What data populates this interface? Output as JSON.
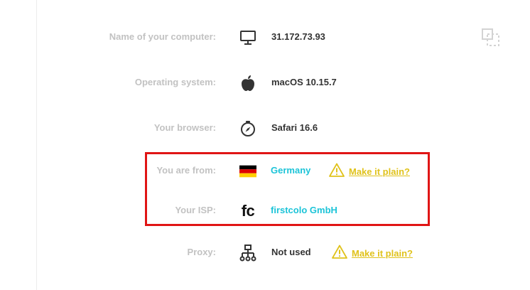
{
  "rows": [
    {
      "label": "Name of your computer:",
      "value": "31.172.73.93",
      "icon": "monitor-icon"
    },
    {
      "label": "Operating system:",
      "value": "macOS 10.15.7",
      "icon": "apple-icon"
    },
    {
      "label": "Your browser:",
      "value": "Safari 16.6",
      "icon": "compass-icon"
    },
    {
      "label": "You are from:",
      "value": "Germany",
      "icon": "germany-flag-icon",
      "action": "Make it plain?"
    },
    {
      "label": "Your ISP:",
      "value": "firstcolo GmbH",
      "icon": "isp-logo",
      "logo_text": "fc"
    },
    {
      "label": "Proxy:",
      "value": "Not used",
      "icon": "network-icon",
      "action": "Make it plain?"
    }
  ],
  "colors": {
    "label": "#c2c2c2",
    "value": "#333333",
    "accent": "#1cc4d8",
    "warning": "#e0c21b",
    "highlight": "#e01515"
  }
}
